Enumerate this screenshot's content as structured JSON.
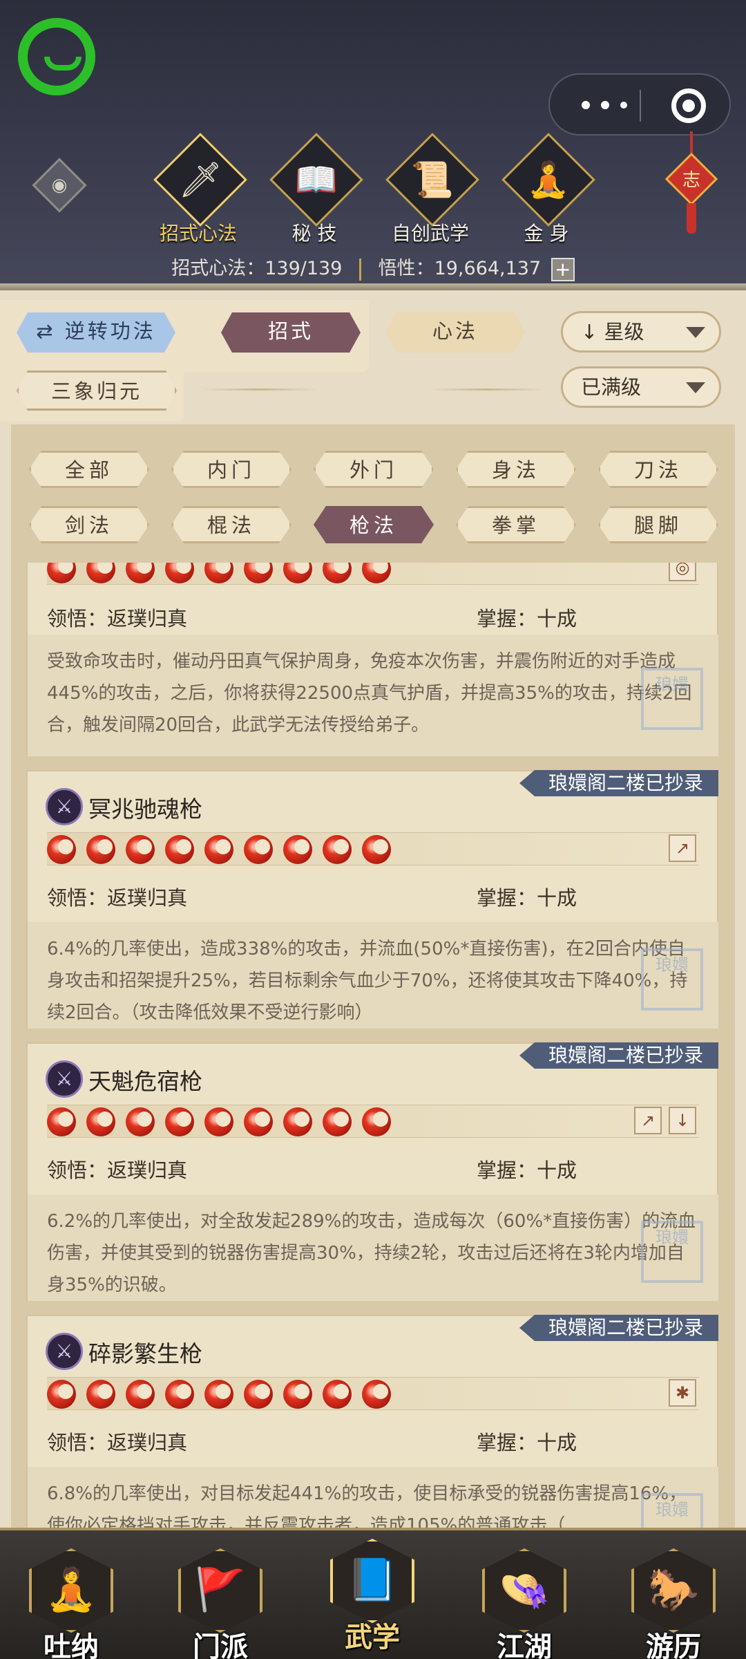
{
  "header": {
    "nav": [
      {
        "label": "招式心法",
        "icon": "sword-icon",
        "glyph": "🗡",
        "active": true
      },
      {
        "label": "秘 技",
        "icon": "book-icon",
        "glyph": "📖",
        "active": false
      },
      {
        "label": "自创武学",
        "icon": "scroll-icon",
        "glyph": "📜",
        "active": false
      },
      {
        "label": "金 身",
        "icon": "meditation-icon",
        "glyph": "🧘",
        "active": false
      }
    ],
    "stats": {
      "moves_label": "招式心法：139/139",
      "insight_label": "悟性：19,664,137",
      "plus": "+"
    },
    "charm_text": "志"
  },
  "filters": {
    "reverse": "逆转功法",
    "moves": "招式",
    "mind": "心法",
    "sort": "星级",
    "sanxiang": "三象归元",
    "level": "已满级"
  },
  "categories": [
    "全部",
    "内门",
    "外门",
    "身法",
    "刀法",
    "剑法",
    "棍法",
    "枪法",
    "拳掌",
    "腿脚"
  ],
  "active_category": "枪法",
  "cards": [
    {
      "name": "",
      "tag": "",
      "comprehension": "领悟：返璞归真",
      "mastery": "掌握：十成",
      "desc": "受致命攻击时，催动丹田真气保护周身，免疫本次伤害，并震伤附近的对手造成445%的攻击，之后，你将获得22500点真气护盾，并提高35%的攻击，持续2回合，触发间隔20回合，此武学无法传授给弟子。"
    },
    {
      "name": "冥兆驰魂枪",
      "tag": "琅嬛阁二楼已抄录",
      "comprehension": "领悟：返璞归真",
      "mastery": "掌握：十成",
      "desc": "6.4%的几率使出，造成338%的攻击，并流血(50%*直接伤害)，在2回合内使自身攻击和招架提升25%，若目标剩余气血少于70%，还将使其攻击下降40%，持续2回合。（攻击降低效果不受逆行影响）"
    },
    {
      "name": "天魁危宿枪",
      "tag": "琅嬛阁二楼已抄录",
      "comprehension": "领悟：返璞归真",
      "mastery": "掌握：十成",
      "desc": "6.2%的几率使出，对全敌发起289%的攻击，造成每次（60%*直接伤害）的流血伤害，并使其受到的锐器伤害提高30%，持续2轮，攻击过后还将在3轮内增加自身35%的识破。"
    },
    {
      "name": "碎影繁生枪",
      "tag": "琅嬛阁二楼已抄录",
      "comprehension": "领悟：返璞归真",
      "mastery": "掌握：十成",
      "desc": "6.8%的几率使出，对目标发起441%的攻击，使目标承受的锐器伤害提高16%，使你必定格挡对手攻击，并反震攻击者，造成105%的普通攻击（"
    }
  ],
  "seal_text": "琅嬛",
  "bottom_nav": [
    {
      "label": "吐纳",
      "icon": "monk-icon",
      "glyph": "🧘",
      "active": false
    },
    {
      "label": "门派",
      "icon": "banner-icon",
      "glyph": "🚩",
      "active": false
    },
    {
      "label": "武学",
      "icon": "book-icon",
      "glyph": "📘",
      "active": true
    },
    {
      "label": "江湖",
      "icon": "straw-hat-icon",
      "glyph": "👒",
      "active": false
    },
    {
      "label": "游历",
      "icon": "horse-icon",
      "glyph": "🐎",
      "active": false
    }
  ]
}
